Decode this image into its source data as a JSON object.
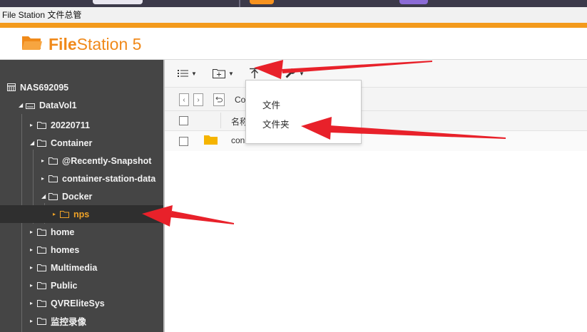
{
  "window": {
    "title": "File Station 文件总管"
  },
  "brand": {
    "name_bold": "File",
    "name_rest": "Station 5",
    "accent": "#f39a1c"
  },
  "sidebar": {
    "root": "NAS692095",
    "volume": "DataVol1",
    "items": [
      {
        "label": "20220711"
      },
      {
        "label": "Container"
      },
      {
        "label": "@Recently-Snapshot"
      },
      {
        "label": "container-station-data"
      },
      {
        "label": "Docker"
      },
      {
        "label": "nps",
        "selected": true
      },
      {
        "label": "home"
      },
      {
        "label": "homes"
      },
      {
        "label": "Multimedia"
      },
      {
        "label": "Public"
      },
      {
        "label": "QVREliteSys"
      },
      {
        "label": "监控录像"
      }
    ]
  },
  "toolbar": {
    "view_icon": "list-icon",
    "new_folder_icon": "new-folder-icon",
    "upload_icon": "upload-icon",
    "tools_icon": "wrench-icon"
  },
  "navigation": {
    "path_text": "Co"
  },
  "file_list": {
    "column_name": "名称",
    "rows": [
      {
        "name": "con"
      }
    ]
  },
  "upload_menu": {
    "items": [
      {
        "label": "文件"
      },
      {
        "label": "文件夹"
      }
    ]
  },
  "colors": {
    "annotation_arrow": "#e8212a",
    "selected_text": "#f0a327",
    "folder": "#f5b400"
  }
}
